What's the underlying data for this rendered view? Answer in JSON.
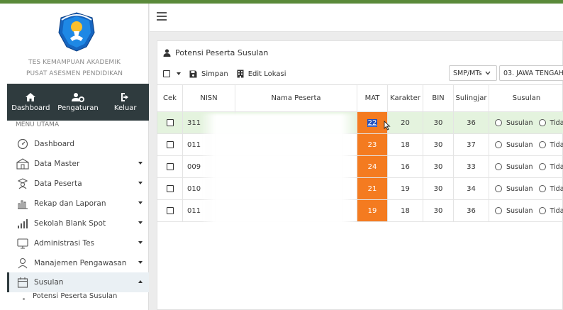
{
  "sidebar": {
    "brand_line1": "TES KEMAMPUAN AKADEMIK",
    "brand_line2": "PUSAT ASESMEN PENDIDIKAN",
    "top_nav": [
      {
        "label": "Dashboard",
        "icon": "home-icon"
      },
      {
        "label": "Pengaturan",
        "icon": "users-gear-icon"
      },
      {
        "label": "Keluar",
        "icon": "sign-out-icon"
      }
    ],
    "menu_caption": "MENU UTAMA",
    "menu": [
      {
        "label": "Dashboard",
        "icon": "dashboard-icon",
        "has_caret": false
      },
      {
        "label": "Data Master",
        "icon": "building-icon",
        "has_caret": true
      },
      {
        "label": "Data Peserta",
        "icon": "student-icon",
        "has_caret": true
      },
      {
        "label": "Rekap dan Laporan",
        "icon": "chart-icon",
        "has_caret": true
      },
      {
        "label": "Sekolah Blank Spot",
        "icon": "signal-icon",
        "has_caret": true
      },
      {
        "label": "Administrasi Tes",
        "icon": "monitor-icon",
        "has_caret": true
      },
      {
        "label": "Manajemen Pengawasan",
        "icon": "supervisor-icon",
        "has_caret": true
      },
      {
        "label": "Susulan",
        "icon": "calendar-icon",
        "has_caret": true,
        "active": true
      }
    ],
    "sub_item": "Potensi Peserta Susulan"
  },
  "card": {
    "title": "Potensi Peserta Susulan",
    "save_label": "Simpan",
    "edit_label": "Edit Lokasi",
    "level_select": "SMP/MTs",
    "province_select": "03. JAWA TENGAH"
  },
  "table": {
    "headers": [
      "Cek",
      "NISN",
      "Nama Peserta",
      "MAT",
      "Karakter",
      "BIN",
      "Sulingjar",
      "Susulan"
    ],
    "radio_labels": [
      "Susulan",
      "Tida"
    ],
    "rows": [
      {
        "nisn": "311",
        "mat": "22",
        "karakter": "20",
        "bin": "30",
        "sulingjar": "36"
      },
      {
        "nisn": "011",
        "mat": "23",
        "karakter": "18",
        "bin": "30",
        "sulingjar": "37"
      },
      {
        "nisn": "009",
        "mat": "24",
        "karakter": "16",
        "bin": "30",
        "sulingjar": "33"
      },
      {
        "nisn": "010",
        "mat": "21",
        "karakter": "19",
        "bin": "30",
        "sulingjar": "34"
      },
      {
        "nisn": "011",
        "mat": "19",
        "karakter": "18",
        "bin": "30",
        "sulingjar": "36"
      }
    ]
  },
  "colors": {
    "accent_green": "#5a8a3a",
    "nav_dark": "#2f3b3e",
    "mat_orange": "#f47b20",
    "row_highlight": "#e4f3de",
    "selection_blue": "#1f4fbf"
  }
}
